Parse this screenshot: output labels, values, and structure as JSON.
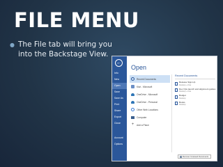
{
  "slide": {
    "title": "FILE MENU",
    "bullet_text": "The File tab will bring you into the Backstage View."
  },
  "backstage": {
    "title": "Open",
    "back_icon": "back-arrow-icon",
    "nav": [
      "Info",
      "New",
      "Open",
      "Save",
      "Save As",
      "Print",
      "Share",
      "Export",
      "Close",
      "Account",
      "Options"
    ],
    "locations": [
      {
        "label": "Recent Documents",
        "icon": "clock-icon"
      },
      {
        "label": "Kiwi - Microsoft",
        "icon": "share-icon"
      },
      {
        "label": "OneDrive - Microsoft",
        "icon": "cloud-icon"
      },
      {
        "label": "OneDrive - Personal",
        "icon": "cloud-icon"
      },
      {
        "label": "Other Web Locations",
        "icon": "globe-icon"
      },
      {
        "label": "Computer",
        "icon": "computer-icon"
      },
      {
        "label": "Add a Place",
        "icon": "plus-icon"
      }
    ],
    "recent_header": "Recent Documents",
    "recent": [
      {
        "name": "Release Sign-Up",
        "path": "Desktop » Kiwi"
      },
      {
        "name": "Dev Ops launch and alignment guides",
        "path": "Desktop » Kiwi"
      },
      {
        "name": "Budget",
        "path": "Desktop"
      },
      {
        "name": "Books",
        "path": "Desktop"
      }
    ],
    "recover_label": "Recover Unsaved Documents"
  },
  "colors": {
    "backstage_blue": "#2b579a",
    "slide_bg": "#213447"
  }
}
